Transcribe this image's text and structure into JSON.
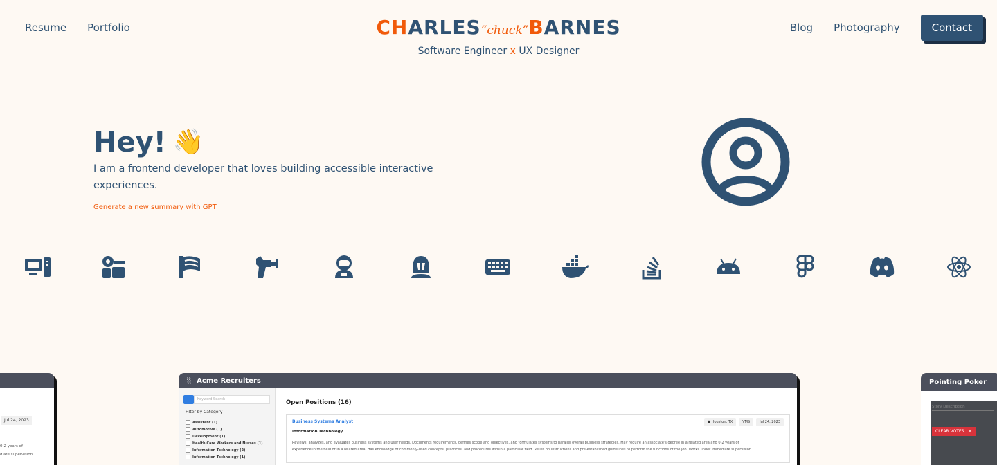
{
  "nav": {
    "left": [
      "Resume",
      "Portfolio"
    ],
    "right": [
      "Blog",
      "Photography"
    ],
    "contact": "Contact"
  },
  "brand": {
    "first_a": "CH",
    "first_b": "ARLES",
    "nickname": "“chuck”",
    "last_a": "B",
    "last_b": "ARNES",
    "subtitle_a": "Software Engineer",
    "subtitle_x": "x",
    "subtitle_b": "UX Designer"
  },
  "hero": {
    "title": "Hey!",
    "wave": "👋",
    "text": "I am a frontend developer that loves building accessible interactive experiences.",
    "gpt_link": "Generate a new summary with GPT"
  },
  "icons": [
    "computer-icon",
    "coffee-maker-icon",
    "flag-icon",
    "raygun-icon",
    "astronaut-icon",
    "helmet-icon",
    "keyboard-icon",
    "docker-icon",
    "stack-overflow-icon",
    "android-icon",
    "figma-icon",
    "discord-icon",
    "react-icon"
  ],
  "colors": {
    "primary": "#2f5273",
    "accent": "#f15a0a",
    "background": "#fef9f3"
  },
  "cards": {
    "left": {
      "date": "Jul 24, 2023",
      "line1": "0-2 years of",
      "line2": "diate supervision"
    },
    "main": {
      "title": "Acme Recruiters",
      "search_placeholder": "Keyword Search",
      "filter_label": "Filter by Category",
      "categories": [
        "Assistant (1)",
        "Automotive (1)",
        "Development (1)",
        "Health Care Workers and Nurses (1)",
        "Information Technology (2)",
        "Information Technology (1)"
      ],
      "open_positions": "Open Positions (16)",
      "job": {
        "title": "Business Systems Analyst",
        "location": "Houston, TX",
        "type": "VMS",
        "date": "Jul 24, 2023",
        "category": "Information Technology",
        "desc1": "Reviews, analyzes, and evaluates business systems and user needs. Documents requirements, defines scope and objectives, and formulates systems to parallel overall business strategies. May require an associate's degree in a related area and 0-2 years of",
        "desc2": "experience in the field or in a related area. Has knowledge of commonly-used concepts, practices, and procedures within a particular field. Relies on instructions and pre-established guidelines to perform the functions of the job. Works under immediate supervision."
      }
    },
    "right": {
      "title": "Pointing Poker",
      "story_placeholder": "Story Description",
      "clear_votes": "CLEAR VOTES"
    }
  }
}
